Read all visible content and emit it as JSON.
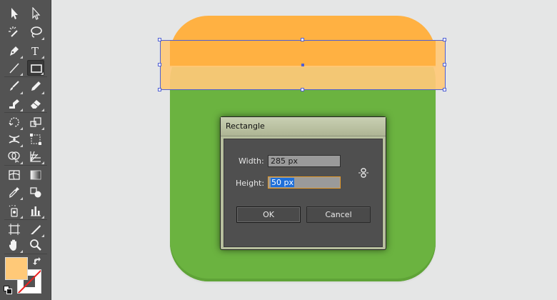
{
  "toolbar": {
    "tools": [
      {
        "name": "selection-tool",
        "icon": "arrow-icon"
      },
      {
        "name": "direct-selection-tool",
        "icon": "white-arrow-icon"
      },
      {
        "name": "magic-wand-tool",
        "icon": "magic-wand-icon"
      },
      {
        "name": "lasso-tool",
        "icon": "lasso-icon"
      },
      {
        "name": "pen-tool",
        "icon": "pen-icon"
      },
      {
        "name": "type-tool",
        "icon": "type-icon",
        "glyph": "T"
      },
      {
        "name": "line-segment-tool",
        "icon": "line-icon"
      },
      {
        "name": "rectangle-tool",
        "icon": "rectangle-icon",
        "active": true
      },
      {
        "name": "paintbrush-tool",
        "icon": "brush-icon"
      },
      {
        "name": "pencil-tool",
        "icon": "pencil-icon"
      },
      {
        "name": "blob-brush-tool",
        "icon": "blob-brush-icon"
      },
      {
        "name": "eraser-tool",
        "icon": "eraser-icon"
      },
      {
        "name": "rotate-tool",
        "icon": "rotate-icon"
      },
      {
        "name": "scale-tool",
        "icon": "scale-icon"
      },
      {
        "name": "width-tool",
        "icon": "width-icon"
      },
      {
        "name": "free-transform-tool",
        "icon": "free-transform-icon"
      },
      {
        "name": "shape-builder-tool",
        "icon": "shape-builder-icon"
      },
      {
        "name": "perspective-grid-tool",
        "icon": "perspective-grid-icon"
      },
      {
        "name": "mesh-tool",
        "icon": "mesh-icon"
      },
      {
        "name": "gradient-tool",
        "icon": "gradient-icon"
      },
      {
        "name": "eyedropper-tool",
        "icon": "eyedropper-icon"
      },
      {
        "name": "blend-tool",
        "icon": "blend-icon"
      },
      {
        "name": "symbol-sprayer-tool",
        "icon": "symbol-sprayer-icon"
      },
      {
        "name": "column-graph-tool",
        "icon": "column-graph-icon"
      },
      {
        "name": "artboard-tool",
        "icon": "artboard-icon"
      },
      {
        "name": "slice-tool",
        "icon": "slice-icon"
      },
      {
        "name": "hand-tool",
        "icon": "hand-icon"
      },
      {
        "name": "zoom-tool",
        "icon": "zoom-icon"
      }
    ],
    "fill_color": "#ffc978",
    "stroke_color": "none"
  },
  "artwork": {
    "base_color": "#6bb340",
    "top_color": "#ffb142",
    "new_rect_color": "#ffc978",
    "selection_color": "#4f5fd4"
  },
  "dialog": {
    "title": "Rectangle",
    "width_label": "Width:",
    "width_value": "285 px",
    "height_label": "Height:",
    "height_value": "50 px",
    "ok_label": "OK",
    "cancel_label": "Cancel",
    "link_icon": "constrain-proportions-icon"
  }
}
